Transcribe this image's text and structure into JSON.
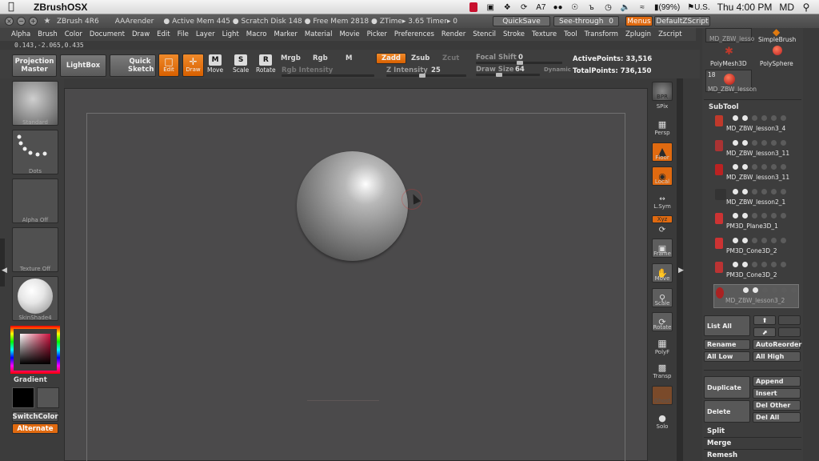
{
  "menubar": {
    "app_name": "ZBrushOSX",
    "adobe_label": "7",
    "battery": "(99%)",
    "locale": "U.S.",
    "clock": "Thu 4:00 PM",
    "user": "MD"
  },
  "title_strip": {
    "title": "ZBrush 4R6",
    "aarender": "AAArender",
    "status": "● Active Mem 445  ● Scratch Disk 148  ● Free Mem 2818  ● ZTime▸ 3.65  Timer▸ 0",
    "quicksave": "QuickSave",
    "see_through": "See-through",
    "see_through_value": "0",
    "menus": "Menus",
    "default_zscript": "DefaultZScript"
  },
  "menus": [
    "Alpha",
    "Brush",
    "Color",
    "Document",
    "Draw",
    "Edit",
    "File",
    "Layer",
    "Light",
    "Macro",
    "Marker",
    "Material",
    "Movie",
    "Picker",
    "Preferences",
    "Render",
    "Stencil",
    "Stroke",
    "Texture",
    "Tool",
    "Transform",
    "Zplugin",
    "Zscript"
  ],
  "coords": "0.143,-2.065,0.435",
  "toolbar": {
    "projection_master": "Projection Master",
    "lightbox": "LightBox",
    "quick_sketch": "Quick Sketch",
    "edit": "Edit",
    "draw": "Draw",
    "move": "Move",
    "scale": "Scale",
    "rotate": "Rotate",
    "mrgb": "Mrgb",
    "rgb": "Rgb",
    "m": "M",
    "rgb_intensity": "Rgb Intensity",
    "zadd": "Zadd",
    "zsub": "Zsub",
    "zcut": "Zcut",
    "z_intensity_label": "Z Intensity",
    "z_intensity": "25",
    "focal_shift_label": "Focal Shift",
    "focal_shift": "0",
    "draw_size_label": "Draw Size",
    "draw_size": "64",
    "dynamic": "Dynamic",
    "active_points": "ActivePoints: 33,516",
    "total_points": "TotalPoints: 736,150"
  },
  "left": {
    "standard": "Standard",
    "dots": "Dots",
    "alpha_off": "Alpha  Off",
    "texture_off": "Texture  Off",
    "skinshade": "SkinShade4",
    "gradient": "Gradient",
    "switch_color": "SwitchColor",
    "alternate": "Alternate"
  },
  "right_shelf": [
    "BPR",
    "SPix",
    "Persp",
    "Floor",
    "Local",
    "L.Sym",
    "Xyz",
    "Frame",
    "Move",
    "Scale",
    "Rotate",
    "PolyF",
    "Transp",
    "Ghost",
    "Solo"
  ],
  "tool_palette": {
    "tile_simplebrush": "SimpleBrush",
    "tile_polymesh": "PolyMesh3D",
    "tile_polysphere": "PolySphere",
    "tile_count": "18",
    "tile_lesson": "MD_ZBW_lesson",
    "tile_lesson_top": "MD_ZBW_lesso"
  },
  "subtool": {
    "header": "SubTool",
    "items": [
      "MD_ZBW_lesson3_4",
      "MD_ZBW_lesson3_11",
      "MD_ZBW_lesson3_11",
      "MD_ZBW_lesson2_1",
      "PM3D_Plane3D_1",
      "PM3D_Cone3D_2",
      "PM3D_Cone3D_2",
      "MD_ZBW_lesson3_2"
    ],
    "list_all": "List  All",
    "rename": "Rename",
    "auto_reorder": "AutoReorder",
    "all_low": "All Low",
    "all_high": "All High",
    "duplicate": "Duplicate",
    "append": "Append",
    "insert": "Insert",
    "delete": "Delete",
    "del_other": "Del Other",
    "del_all": "Del All",
    "split": "Split",
    "merge": "Merge",
    "remesh": "Remesh"
  }
}
